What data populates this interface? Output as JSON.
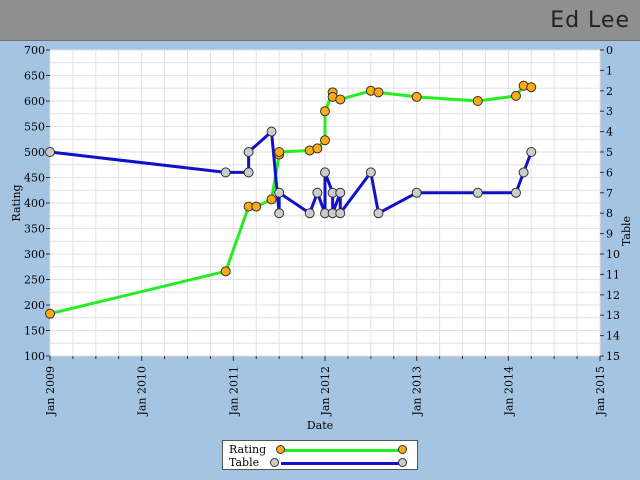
{
  "header": {
    "player_name": "Ed Lee"
  },
  "chart_data": {
    "type": "line",
    "xlabel": "Date",
    "ylabel_left": "Rating",
    "ylabel_right": "Table",
    "x_ticks": [
      "Jan 2009",
      "Jan 2010",
      "Jan 2011",
      "Jan 2012",
      "Jan 2013",
      "Jan 2014",
      "Jan 2015"
    ],
    "x_range": [
      "2009-01",
      "2015-01"
    ],
    "y_left_range": [
      100,
      700
    ],
    "y_left_ticks": [
      100,
      150,
      200,
      250,
      300,
      350,
      400,
      450,
      500,
      550,
      600,
      650,
      700
    ],
    "y_right_range": [
      0,
      15
    ],
    "y_right_ticks": [
      0,
      1,
      2,
      3,
      4,
      5,
      6,
      7,
      8,
      9,
      10,
      11,
      12,
      13,
      14,
      15
    ],
    "y_right_inverted": true,
    "grid": true,
    "legend_position": "bottom-center",
    "series": [
      {
        "name": "Rating",
        "axis": "left",
        "line_color": "#22ee22",
        "marker_color": "#ffaa11",
        "points": [
          [
            "2009-01",
            183
          ],
          [
            "2010-12",
            266
          ],
          [
            "2011-03",
            393
          ],
          [
            "2011-04",
            393
          ],
          [
            "2011-06",
            407
          ],
          [
            "2011-07",
            495
          ],
          [
            "2011-07",
            500
          ],
          [
            "2011-11",
            503
          ],
          [
            "2011-12",
            507
          ],
          [
            "2012-01",
            523
          ],
          [
            "2012-01",
            580
          ],
          [
            "2012-02",
            617
          ],
          [
            "2012-02",
            608
          ],
          [
            "2012-03",
            603
          ],
          [
            "2012-07",
            620
          ],
          [
            "2012-08",
            617
          ],
          [
            "2013-01",
            608
          ],
          [
            "2013-09",
            600
          ],
          [
            "2014-02",
            610
          ],
          [
            "2014-03",
            630
          ],
          [
            "2014-04",
            627
          ]
        ]
      },
      {
        "name": "Table",
        "axis": "right",
        "line_color": "#1111cc",
        "marker_color": "#cccccc",
        "points": [
          [
            "2009-01",
            5
          ],
          [
            "2010-12",
            6
          ],
          [
            "2011-03",
            6
          ],
          [
            "2011-03",
            5
          ],
          [
            "2011-06",
            4
          ],
          [
            "2011-07",
            8
          ],
          [
            "2011-07",
            7
          ],
          [
            "2011-11",
            8
          ],
          [
            "2011-12",
            7
          ],
          [
            "2012-01",
            8
          ],
          [
            "2012-01",
            6
          ],
          [
            "2012-02",
            7
          ],
          [
            "2012-02",
            8
          ],
          [
            "2012-03",
            7
          ],
          [
            "2012-03",
            8
          ],
          [
            "2012-07",
            6
          ],
          [
            "2012-08",
            8
          ],
          [
            "2013-01",
            7
          ],
          [
            "2013-09",
            7
          ],
          [
            "2014-02",
            7
          ],
          [
            "2014-03",
            6
          ],
          [
            "2014-04",
            5
          ]
        ]
      }
    ]
  }
}
